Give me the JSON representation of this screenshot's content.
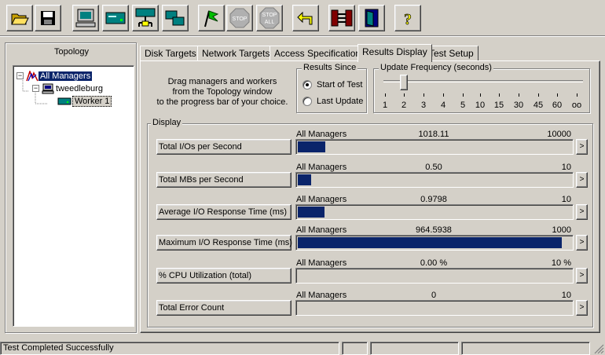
{
  "toolbar": {
    "buttons": [
      {
        "icon": "open-folder-icon"
      },
      {
        "icon": "save-disk-icon"
      },
      {
        "icon": "display-computer-icon"
      },
      {
        "icon": "manager-disk-icon"
      },
      {
        "icon": "network-hub-icon"
      },
      {
        "icon": "copy-worker-icon"
      },
      {
        "icon": "start-flag-icon"
      },
      {
        "icon": "stop-icon",
        "label": "STOP"
      },
      {
        "icon": "stop-all-icon",
        "label_top": "STOP",
        "label_bottom": "ALL"
      },
      {
        "icon": "reset-arrow-icon"
      },
      {
        "icon": "disconnect-icon"
      },
      {
        "icon": "exit-door-icon"
      },
      {
        "icon": "help-icon",
        "label": "?"
      }
    ]
  },
  "topology": {
    "title": "Topology",
    "items": [
      {
        "label": "All Managers",
        "level": 0,
        "expander": "−",
        "selected": true
      },
      {
        "label": "tweedleburg",
        "level": 1,
        "expander": "−"
      },
      {
        "label": "Worker 1",
        "level": 2
      }
    ]
  },
  "tabs": [
    {
      "label": "Disk Targets"
    },
    {
      "label": "Network Targets"
    },
    {
      "label": "Access Specifications"
    },
    {
      "label": "Results Display",
      "active": true
    },
    {
      "label": "Test Setup"
    }
  ],
  "instructions": {
    "line1": "Drag managers and workers",
    "line2": "from the Topology window",
    "line3": "to the progress bar of your choice."
  },
  "results_since": {
    "title": "Results Since",
    "options": [
      "Start of Test",
      "Last Update"
    ],
    "selected": "Start of Test"
  },
  "update_frequency": {
    "title": "Update Frequency (seconds)",
    "ticks": [
      "1",
      "2",
      "3",
      "4",
      "5",
      "10",
      "15",
      "30",
      "45",
      "60",
      "oo"
    ],
    "value": "2"
  },
  "display": {
    "title": "Display",
    "rows": [
      {
        "label": "Total I/Os per Second",
        "source": "All Managers",
        "value": "1018.11",
        "max": "10000",
        "fraction": 0.1018
      },
      {
        "label": "Total MBs per Second",
        "source": "All Managers",
        "value": "0.50",
        "max": "10",
        "fraction": 0.05
      },
      {
        "label": "Average I/O Response Time (ms)",
        "source": "All Managers",
        "value": "0.9798",
        "max": "10",
        "fraction": 0.098
      },
      {
        "label": "Maximum I/O Response Time (ms)",
        "source": "All Managers",
        "value": "964.5938",
        "max": "1000",
        "fraction": 0.9646
      },
      {
        "label": "% CPU Utilization (total)",
        "source": "All Managers",
        "value": "0.00 %",
        "max": "10 %",
        "fraction": 0
      },
      {
        "label": "Total Error Count",
        "source": "All Managers",
        "value": "0",
        "max": "10",
        "fraction": 0
      }
    ],
    "arrow": ">"
  },
  "status": {
    "message": "Test Completed Successfully"
  },
  "colors": {
    "face": "#d4d0c8",
    "bar_fill": "#0a246a",
    "selection": "#0a246a"
  }
}
